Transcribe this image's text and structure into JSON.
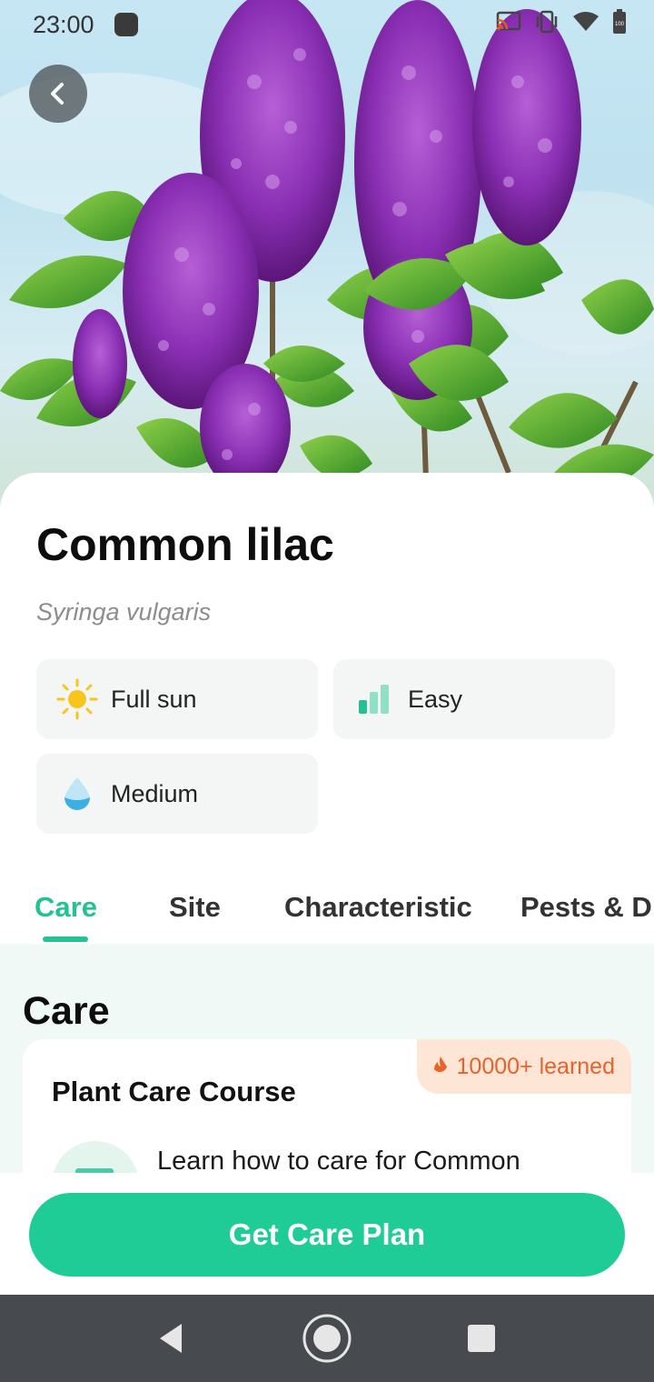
{
  "status_bar": {
    "time": "23:00",
    "battery_level": "100"
  },
  "plant": {
    "common_name": "Common lilac",
    "latin_name": "Syringa vulgaris"
  },
  "attributes": [
    {
      "label": "Full sun",
      "icon": "sun-icon"
    },
    {
      "label": "Easy",
      "icon": "difficulty-bars-icon"
    },
    {
      "label": "Medium",
      "icon": "water-drop-icon"
    }
  ],
  "tabs": [
    {
      "label": "Care",
      "active": true
    },
    {
      "label": "Site",
      "active": false
    },
    {
      "label": "Characteristic",
      "active": false
    },
    {
      "label": "Pests & D",
      "active": false
    }
  ],
  "care": {
    "heading": "Care",
    "course": {
      "title": "Plant Care Course",
      "badge": "10000+ learned",
      "description": "Learn how to care for Common"
    }
  },
  "cta": {
    "label": "Get Care Plan"
  },
  "colors": {
    "accent": "#1fcc95",
    "badge_bg": "#fde6d6",
    "badge_text": "#e8622a",
    "nav_bar": "#474a4e"
  },
  "icons": {
    "back": "chevron-left-icon",
    "cast": "cast-icon",
    "vibrate": "vibrate-icon",
    "wifi": "wifi-icon",
    "battery": "battery-icon",
    "nav_back": "triangle-back-icon",
    "nav_home": "circle-home-icon",
    "nav_recents": "square-recents-icon"
  }
}
